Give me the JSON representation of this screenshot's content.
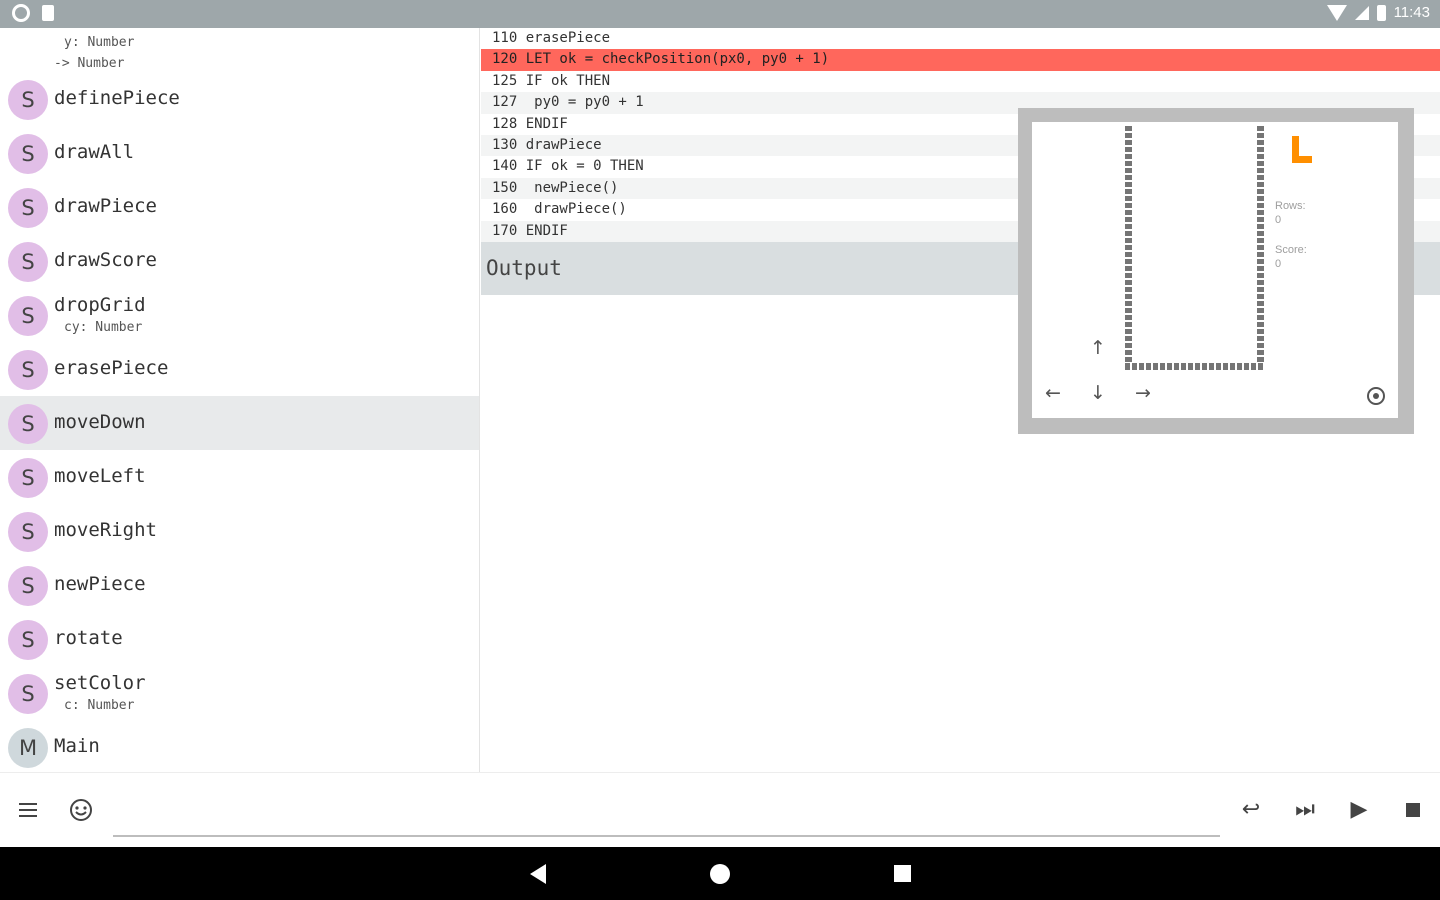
{
  "status_bar": {
    "time": "11:43"
  },
  "sidebar": {
    "signature_lines": [
      "y: Number",
      "-> Number"
    ],
    "items": [
      {
        "avatar": "S",
        "name": "definePiece",
        "param": ""
      },
      {
        "avatar": "S",
        "name": "drawAll",
        "param": ""
      },
      {
        "avatar": "S",
        "name": "drawPiece",
        "param": ""
      },
      {
        "avatar": "S",
        "name": "drawScore",
        "param": ""
      },
      {
        "avatar": "S",
        "name": "dropGrid",
        "param": "cy: Number"
      },
      {
        "avatar": "S",
        "name": "erasePiece",
        "param": ""
      },
      {
        "avatar": "S",
        "name": "moveDown",
        "param": "",
        "selected": true
      },
      {
        "avatar": "S",
        "name": "moveLeft",
        "param": ""
      },
      {
        "avatar": "S",
        "name": "moveRight",
        "param": ""
      },
      {
        "avatar": "S",
        "name": "newPiece",
        "param": ""
      },
      {
        "avatar": "S",
        "name": "rotate",
        "param": ""
      },
      {
        "avatar": "S",
        "name": "setColor",
        "param": "c: Number"
      },
      {
        "avatar": "M",
        "name": "Main",
        "param": ""
      }
    ]
  },
  "code": {
    "lines": [
      "110 erasePiece",
      "120 LET ok = checkPosition(px0, py0 + 1)",
      "125 IF ok THEN",
      "127  py0 = py0 + 1",
      "128 ENDIF",
      "130 drawPiece",
      "140 IF ok = 0 THEN",
      "150  newPiece()",
      "160  drawPiece()",
      "170 ENDIF"
    ],
    "current_line_index": 1
  },
  "output": {
    "label": "Output"
  },
  "game": {
    "rows_label": "Rows:",
    "rows_value": "0",
    "score_label": "Score:",
    "score_value": "0",
    "piece_color": "#ff8f00",
    "controls": {
      "up": "↑",
      "left": "←",
      "down": "↓",
      "right": "→",
      "fire_icon": "target-icon"
    }
  },
  "toolbar": {
    "menu_icon": "menu-icon",
    "emoji_icon": "emoji-icon",
    "undo": "↩",
    "step": "⏭",
    "play": "▶",
    "stop_icon": "stop-icon"
  },
  "colors": {
    "status_bar": "#9ea7aa",
    "current_line": "#ff675c",
    "sub_avatar": "#e1bee7",
    "main_avatar": "#cfd8dc",
    "output_bar": "#d9dee0"
  }
}
